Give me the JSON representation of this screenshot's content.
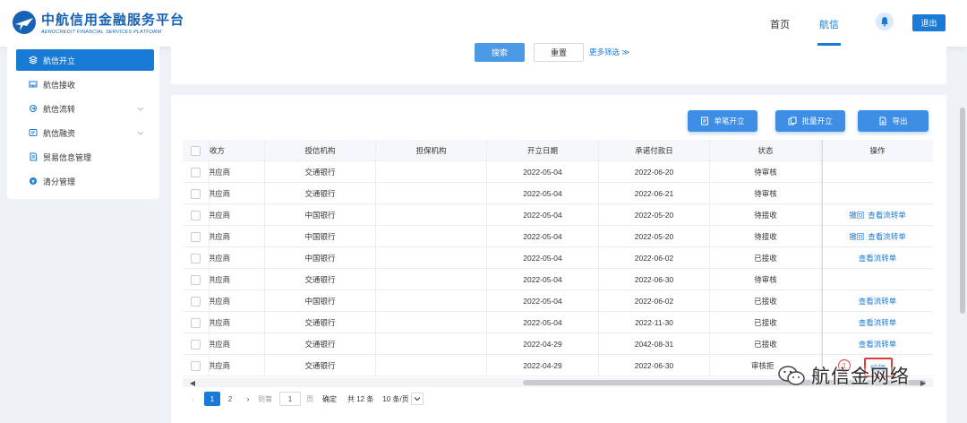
{
  "header": {
    "logo_cn": "中航信用金融服务平台",
    "logo_en": "AEROCREDIT FINANCIAL SERVICES PLATFORM",
    "nav": [
      "首页",
      "航信"
    ],
    "logout": "退出",
    "accent": "#1a7bd6"
  },
  "sidebar": {
    "items": [
      {
        "label": "航信开立",
        "icon": "layers-icon",
        "active": true
      },
      {
        "label": "航信接收",
        "icon": "inbox-icon"
      },
      {
        "label": "航信流转",
        "icon": "transfer-icon"
      },
      {
        "label": "航信融资",
        "icon": "finance-icon"
      },
      {
        "label": "贸易信息管理",
        "icon": "document-icon"
      },
      {
        "label": "清分管理",
        "icon": "settle-icon"
      }
    ]
  },
  "search": {
    "search_label": "搜索",
    "reset_label": "重置",
    "more_label": "更多筛选 ≫"
  },
  "toolbar": {
    "single_label": "单笔开立",
    "batch_label": "批量开立",
    "export_label": "导出"
  },
  "table": {
    "headers": [
      "",
      "收方",
      "授信机构",
      "担保机构",
      "开立日期",
      "承诺付款日",
      "状态",
      "操作"
    ],
    "rows": [
      {
        "party": "X供应商",
        "bank": "交通银行",
        "guarantor": "",
        "open": "2022-05-04",
        "due": "2022-06-20",
        "status": "待审核",
        "ops": []
      },
      {
        "party": "X供应商",
        "bank": "交通银行",
        "guarantor": "",
        "open": "2022-05-04",
        "due": "2022-06-21",
        "status": "待审核",
        "ops": []
      },
      {
        "party": "X供应商",
        "bank": "中国银行",
        "guarantor": "",
        "open": "2022-05-04",
        "due": "2022-05-20",
        "status": "待接收",
        "ops": [
          "撤回",
          "查看流转单"
        ]
      },
      {
        "party": "X供应商",
        "bank": "中国银行",
        "guarantor": "",
        "open": "2022-05-04",
        "due": "2022-05-20",
        "status": "待接收",
        "ops": [
          "撤回",
          "查看流转单"
        ]
      },
      {
        "party": "X供应商",
        "bank": "中国银行",
        "guarantor": "",
        "open": "2022-05-04",
        "due": "2022-06-02",
        "status": "已接收",
        "ops": [
          "查看流转单"
        ]
      },
      {
        "party": "X供应商",
        "bank": "交通银行",
        "guarantor": "",
        "open": "2022-05-04",
        "due": "2022-06-30",
        "status": "待审核",
        "ops": []
      },
      {
        "party": "X供应商",
        "bank": "中国银行",
        "guarantor": "",
        "open": "2022-05-04",
        "due": "2022-06-02",
        "status": "已接收",
        "ops": [
          "查看流转单"
        ]
      },
      {
        "party": "X供应商",
        "bank": "交通银行",
        "guarantor": "",
        "open": "2022-05-04",
        "due": "2022-11-30",
        "status": "已接收",
        "ops": [
          "查看流转单"
        ]
      },
      {
        "party": "X供应商",
        "bank": "交通银行",
        "guarantor": "",
        "open": "2022-04-29",
        "due": "2042-08-31",
        "status": "已接收",
        "ops": [
          "查看流转单"
        ]
      },
      {
        "party": "X供应商",
        "bank": "交通银行",
        "guarantor": "",
        "open": "2022-04-29",
        "due": "2022-06-30",
        "status": "审核拒",
        "ops": [
          "编辑"
        ]
      }
    ]
  },
  "pager": {
    "pages": [
      "1",
      "2"
    ],
    "goto_prefix": "到第",
    "goto_value": "1",
    "goto_suffix": "页",
    "confirm": "确定",
    "total": "共 12 条",
    "page_size": "10 条/页"
  },
  "annotation": {
    "marker": "1",
    "boxed_label": "编辑"
  },
  "watermark": "航信金网络"
}
